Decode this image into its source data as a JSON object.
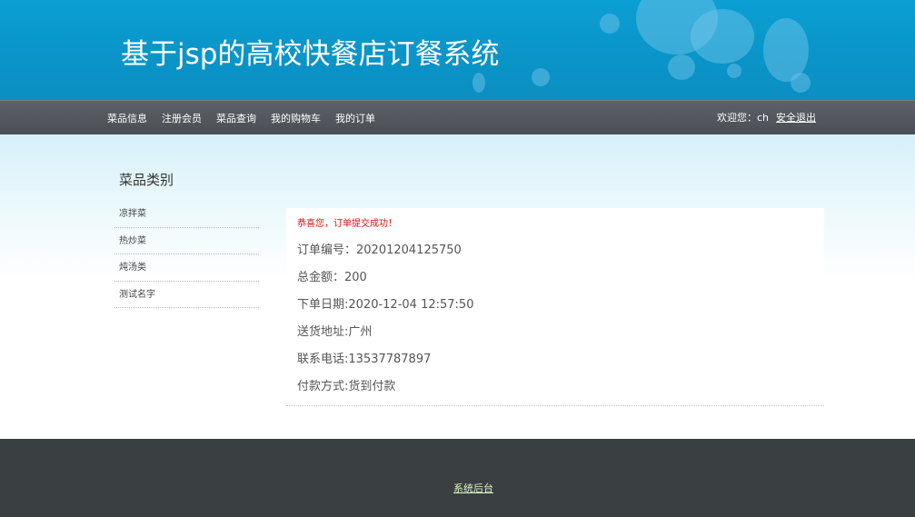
{
  "header": {
    "title": "基于jsp的高校快餐店订餐系统"
  },
  "nav": {
    "items": [
      {
        "label": "菜品信息"
      },
      {
        "label": "注册会员"
      },
      {
        "label": "菜品查询"
      },
      {
        "label": "我的购物车"
      },
      {
        "label": "我的订单"
      }
    ],
    "welcome": "欢迎您：ch",
    "logout": "安全退出"
  },
  "sidebar": {
    "title": "菜品类别",
    "categories": [
      {
        "label": "凉拌菜"
      },
      {
        "label": "热炒菜"
      },
      {
        "label": "炖汤类"
      },
      {
        "label": "测试名字"
      }
    ]
  },
  "order": {
    "success_message": "恭喜您，订单提交成功！",
    "order_no_label": "订单编号：",
    "order_no": "20201204125750",
    "total_label": "总金额：",
    "total": "200",
    "date_label": "下单日期:",
    "date": "2020-12-04 12:57:50",
    "address_label": "送货地址:",
    "address": "广州",
    "phone_label": "联系电话:",
    "phone": "13537787897",
    "payment_label": "付款方式:",
    "payment": "货到付款"
  },
  "footer": {
    "admin_link": "系统后台"
  }
}
